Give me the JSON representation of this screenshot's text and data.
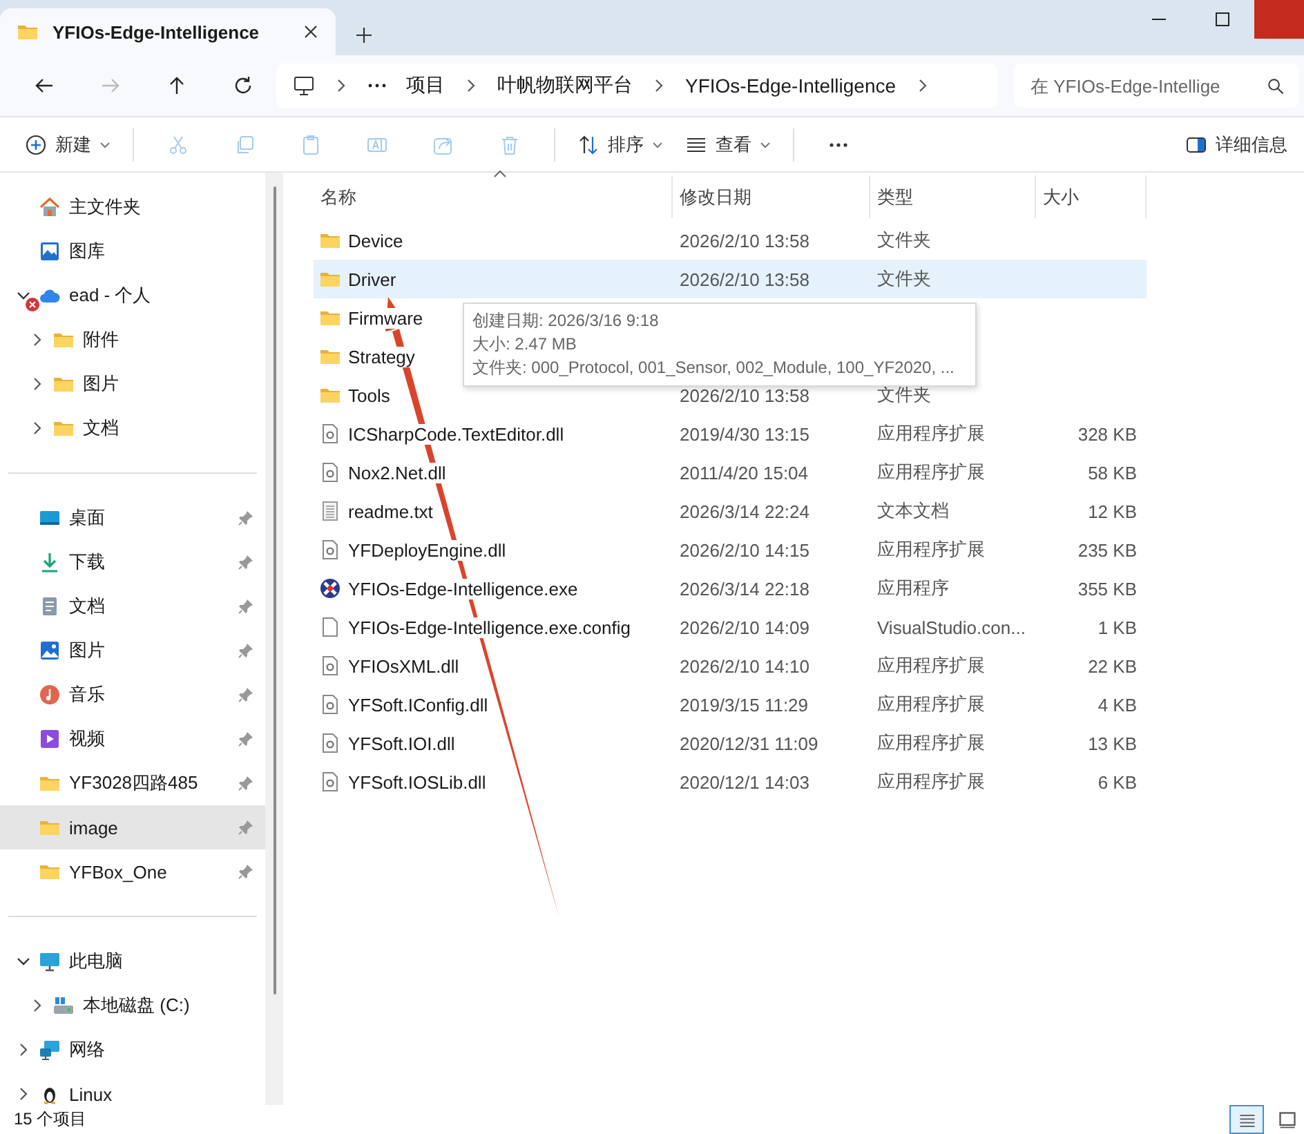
{
  "window": {
    "tab_title": "YFIOs-Edge-Intelligence"
  },
  "nav": [
    {
      "kind": "back",
      "disabled": false
    },
    {
      "kind": "forward",
      "disabled": true
    },
    {
      "kind": "up",
      "disabled": false
    },
    {
      "kind": "refresh",
      "disabled": false
    }
  ],
  "address": {
    "crumbs": [
      "项目",
      "叶帆物联网平台",
      "YFIOs-Edge-Intelligence"
    ]
  },
  "search": {
    "placeholder": "在 YFIOs-Edge-Intellige"
  },
  "toolbar": {
    "items": [
      {
        "kind": "new",
        "label": "新建",
        "disabled": false
      },
      {
        "kind": "cut",
        "disabled": true
      },
      {
        "kind": "copy",
        "disabled": true
      },
      {
        "kind": "paste",
        "disabled": true
      },
      {
        "kind": "rename",
        "disabled": true
      },
      {
        "kind": "share",
        "disabled": true
      },
      {
        "kind": "delete",
        "disabled": true
      },
      {
        "kind": "sort",
        "label": "排序",
        "disabled": false
      },
      {
        "kind": "view",
        "label": "查看",
        "disabled": false
      },
      {
        "kind": "more",
        "disabled": false
      }
    ],
    "details_label": "详细信息"
  },
  "sidebar": {
    "groups": [
      [
        {
          "kind": "home",
          "label": "主文件夹",
          "selected": false,
          "pinned": false
        },
        {
          "kind": "gallery",
          "label": "图库",
          "selected": false,
          "pinned": false
        },
        {
          "kind": "cloud",
          "label": "ead - 个人",
          "selected": false,
          "pinned": false,
          "expanded": true,
          "sync_error": true,
          "children": [
            {
              "kind": "folder",
              "label": "附件",
              "selected": false,
              "pinned": false,
              "expanded": false
            },
            {
              "kind": "folder",
              "label": "图片",
              "selected": false,
              "pinned": false,
              "expanded": false
            },
            {
              "kind": "folder",
              "label": "文档",
              "selected": false,
              "pinned": false,
              "expanded": false
            }
          ]
        }
      ],
      [
        {
          "kind": "desktop",
          "label": "桌面",
          "selected": false,
          "pinned": true
        },
        {
          "kind": "download",
          "label": "下载",
          "selected": false,
          "pinned": true
        },
        {
          "kind": "document",
          "label": "文档",
          "selected": false,
          "pinned": true
        },
        {
          "kind": "picture",
          "label": "图片",
          "selected": false,
          "pinned": true
        },
        {
          "kind": "music",
          "label": "音乐",
          "selected": false,
          "pinned": true
        },
        {
          "kind": "video",
          "label": "视频",
          "selected": false,
          "pinned": true
        },
        {
          "kind": "folder",
          "label": "YF3028四路485",
          "selected": false,
          "pinned": true
        },
        {
          "kind": "folder",
          "label": "image",
          "selected": true,
          "pinned": true
        },
        {
          "kind": "folder",
          "label": "YFBox_One",
          "selected": false,
          "pinned": true
        }
      ],
      [
        {
          "kind": "pc",
          "label": "此电脑",
          "selected": false,
          "pinned": false,
          "expanded": true,
          "children": [
            {
              "kind": "drive",
              "label": "本地磁盘 (C:)",
              "selected": false,
              "pinned": false,
              "expanded": false
            }
          ]
        },
        {
          "kind": "network",
          "label": "网络",
          "selected": false,
          "pinned": false,
          "expanded": false
        },
        {
          "kind": "linux",
          "label": "Linux",
          "selected": false,
          "pinned": false,
          "expanded": false
        }
      ]
    ]
  },
  "columns": [
    {
      "label": "名称",
      "sorted": true
    },
    {
      "label": "修改日期",
      "sorted": false
    },
    {
      "label": "类型",
      "sorted": false
    },
    {
      "label": "大小",
      "sorted": false
    }
  ],
  "files": [
    {
      "kind": "folder",
      "name": "Device",
      "date": "2026/2/10 13:58",
      "type": "文件夹",
      "selected": false
    },
    {
      "kind": "folder",
      "name": "Driver",
      "date": "2026/2/10 13:58",
      "type": "文件夹",
      "selected": true
    },
    {
      "kind": "folder",
      "name": "Firmware",
      "selected": false
    },
    {
      "kind": "folder",
      "name": "Strategy",
      "selected": false
    },
    {
      "kind": "folder",
      "name": "Tools",
      "date": "2026/2/10 13:58",
      "type": "文件夹",
      "selected": false
    },
    {
      "kind": "dll",
      "name": "ICSharpCode.TextEditor.dll",
      "date": "2019/4/30 13:15",
      "type": "应用程序扩展",
      "size": "328 KB",
      "selected": false
    },
    {
      "kind": "dll",
      "name": "Nox2.Net.dll",
      "date": "2011/4/20 15:04",
      "type": "应用程序扩展",
      "size": "58 KB",
      "selected": false
    },
    {
      "kind": "txt",
      "name": "readme.txt",
      "date": "2026/3/14 22:24",
      "type": "文本文档",
      "size": "12 KB",
      "selected": false
    },
    {
      "kind": "dll",
      "name": "YFDeployEngine.dll",
      "date": "2026/2/10 14:15",
      "type": "应用程序扩展",
      "size": "235 KB",
      "selected": false
    },
    {
      "kind": "exe",
      "name": "YFIOs-Edge-Intelligence.exe",
      "date": "2026/3/14 22:18",
      "type": "应用程序",
      "size": "355 KB",
      "selected": false
    },
    {
      "kind": "config",
      "name": "YFIOs-Edge-Intelligence.exe.config",
      "date": "2026/2/10 14:09",
      "type": "VisualStudio.con...",
      "size": "1 KB",
      "selected": false
    },
    {
      "kind": "dll",
      "name": "YFIOsXML.dll",
      "date": "2026/2/10 14:10",
      "type": "应用程序扩展",
      "size": "22 KB",
      "selected": false
    },
    {
      "kind": "dll",
      "name": "YFSoft.IConfig.dll",
      "date": "2019/3/15 11:29",
      "type": "应用程序扩展",
      "size": "4 KB",
      "selected": false
    },
    {
      "kind": "dll",
      "name": "YFSoft.IOI.dll",
      "date": "2020/12/31 11:09",
      "type": "应用程序扩展",
      "size": "13 KB",
      "selected": false
    },
    {
      "kind": "dll",
      "name": "YFSoft.IOSLib.dll",
      "date": "2020/12/1 14:03",
      "type": "应用程序扩展",
      "size": "6 KB",
      "selected": false
    }
  ],
  "tooltip": {
    "lines": [
      "创建日期: 2026/3/16 9:18",
      "大小: 2.47 MB",
      "文件夹: 000_Protocol, 001_Sensor, 002_Module, 100_YF2020, ..."
    ]
  },
  "status_bar": {
    "count": "15 个项目",
    "views": [
      {
        "kind": "details",
        "selected": true
      },
      {
        "kind": "tiles",
        "selected": false
      }
    ]
  }
}
